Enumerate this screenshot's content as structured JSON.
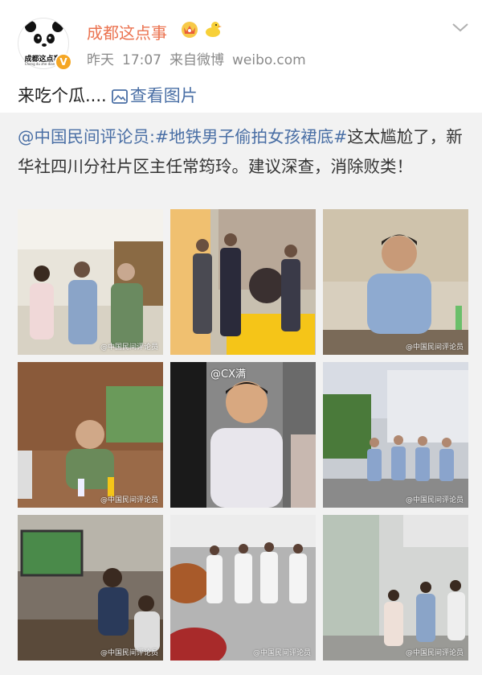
{
  "user": {
    "name": "成都这点事",
    "avatar_text": "成都这点事",
    "avatar_subtext": "Cheng du zhe dian shi",
    "verified_glyph": "V"
  },
  "meta": {
    "time_day": "昨天",
    "time": "17:07",
    "source": "来自微博",
    "site": "weibo.com"
  },
  "post": {
    "text": "来吃个瓜....",
    "view_pictures": "查看图片"
  },
  "repost": {
    "mention": "@中国民间评论员:",
    "hashtag": "#地铁男子偷拍女孩裙底#",
    "text": "这太尴尬了，新华社四川分社片区主任常筠玲。建议深查，消除败类！"
  },
  "images": [
    {
      "name": "photo-office-group",
      "watermark": "@中国民间评论员"
    },
    {
      "name": "photo-ceremony",
      "watermark": ""
    },
    {
      "name": "photo-man-blue-shirt",
      "watermark": "@中国民间评论员"
    },
    {
      "name": "photo-meeting-bald-man",
      "watermark": "@中国民间评论员"
    },
    {
      "name": "photo-closeup-man",
      "watermark": "@CX满"
    },
    {
      "name": "photo-building-group",
      "watermark": "@中国民间评论员"
    },
    {
      "name": "photo-presentation-room",
      "watermark": "@中国民间评论员"
    },
    {
      "name": "photo-car-showroom",
      "watermark": "@中国民间评论员"
    },
    {
      "name": "photo-office-corridor",
      "watermark": "@中国民间评论员"
    }
  ],
  "colors": {
    "username": "#eb7350",
    "link": "#4a6fa5",
    "meta": "#8a8a8a",
    "repost_bg": "#f2f2f2",
    "verified": "#f5a623"
  },
  "icons": {
    "chevron": "chevron-down-icon",
    "picture": "picture-icon",
    "crown": "crown-badge-icon",
    "duck": "duck-badge-icon"
  }
}
